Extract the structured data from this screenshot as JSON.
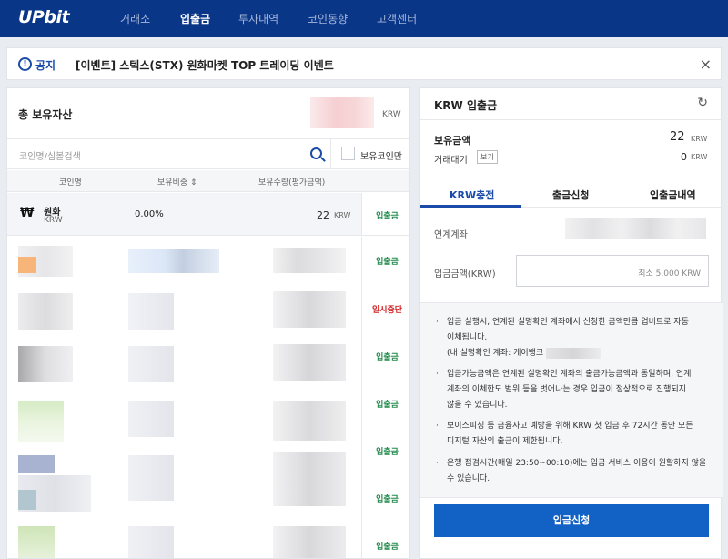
{
  "nav": {
    "logo": "UPbit",
    "items": [
      "거래소",
      "입출금",
      "투자내역",
      "코인동향",
      "고객센터"
    ],
    "active": "입출금"
  },
  "notice": {
    "tag": "공지",
    "text": "[이벤트] 스텍스(STX) 원화마켓 TOP 트레이딩 이벤트",
    "close": "×"
  },
  "assets": {
    "total_label": "총 보유자산",
    "total_unit": "KRW",
    "search_placeholder": "코인명/심볼검색",
    "only_holdings_label": "보유코인만",
    "columns": [
      "코인명",
      "보유비중 ⇕",
      "보유수량(평가금액)"
    ],
    "krw_row": {
      "icon": "₩",
      "name": "원화",
      "code": "KRW",
      "ratio": "0.00%",
      "amount": "22",
      "unit": "KRW",
      "action": "입출금"
    },
    "row_actions": [
      "입출금",
      "일시중단",
      "입출금",
      "입출금",
      "입출금",
      "입출금",
      "입출금"
    ],
    "colors": {
      "action_green": "#218b4c",
      "action_red": "#d21e1e"
    }
  },
  "krw_panel": {
    "title": "KRW 입출금",
    "balance_label": "보유금액",
    "balance_value": "22",
    "balance_unit": "KRW",
    "pending_label": "거래대기",
    "pending_button": "보기",
    "pending_value": "0",
    "pending_unit": "KRW",
    "tabs": [
      "KRW충전",
      "출금신청",
      "입출금내역"
    ],
    "active_tab": "KRW충전",
    "linked_account_label": "연계계좌",
    "deposit_amount_label": "입금금액(KRW)",
    "deposit_amount_placeholder": "최소 5,000 KRW",
    "notes": [
      {
        "lines": [
          "입금 실행시, 연계된 실명확인 계좌에서 신청한 금액만큼 업비트로 자동",
          "이체됩니다.",
          "(내 실명확인 계좌: 케이뱅크"
        ]
      },
      {
        "lines": [
          "입금가능금액은 연계된 실명확인 계좌의 출금가능금액과 동일하며, 연계",
          "계좌의 이체한도 범위 등을 벗어나는 경우 입금이 정상적으로 진행되지",
          "않을 수 있습니다."
        ]
      },
      {
        "lines": [
          "보이스피싱 등 금융사고 예방을 위해 KRW 첫 입금 후 72시간 동안 모든",
          "디지털 자산의 출금이 제한됩니다."
        ]
      },
      {
        "lines": [
          "은행 점검시간(매일 23:50~00:10)에는 입금 서비스 이용이 원활하지 않을",
          "수 있습니다."
        ]
      }
    ],
    "submit_label": "입금신청",
    "accent": "#1261c4"
  }
}
